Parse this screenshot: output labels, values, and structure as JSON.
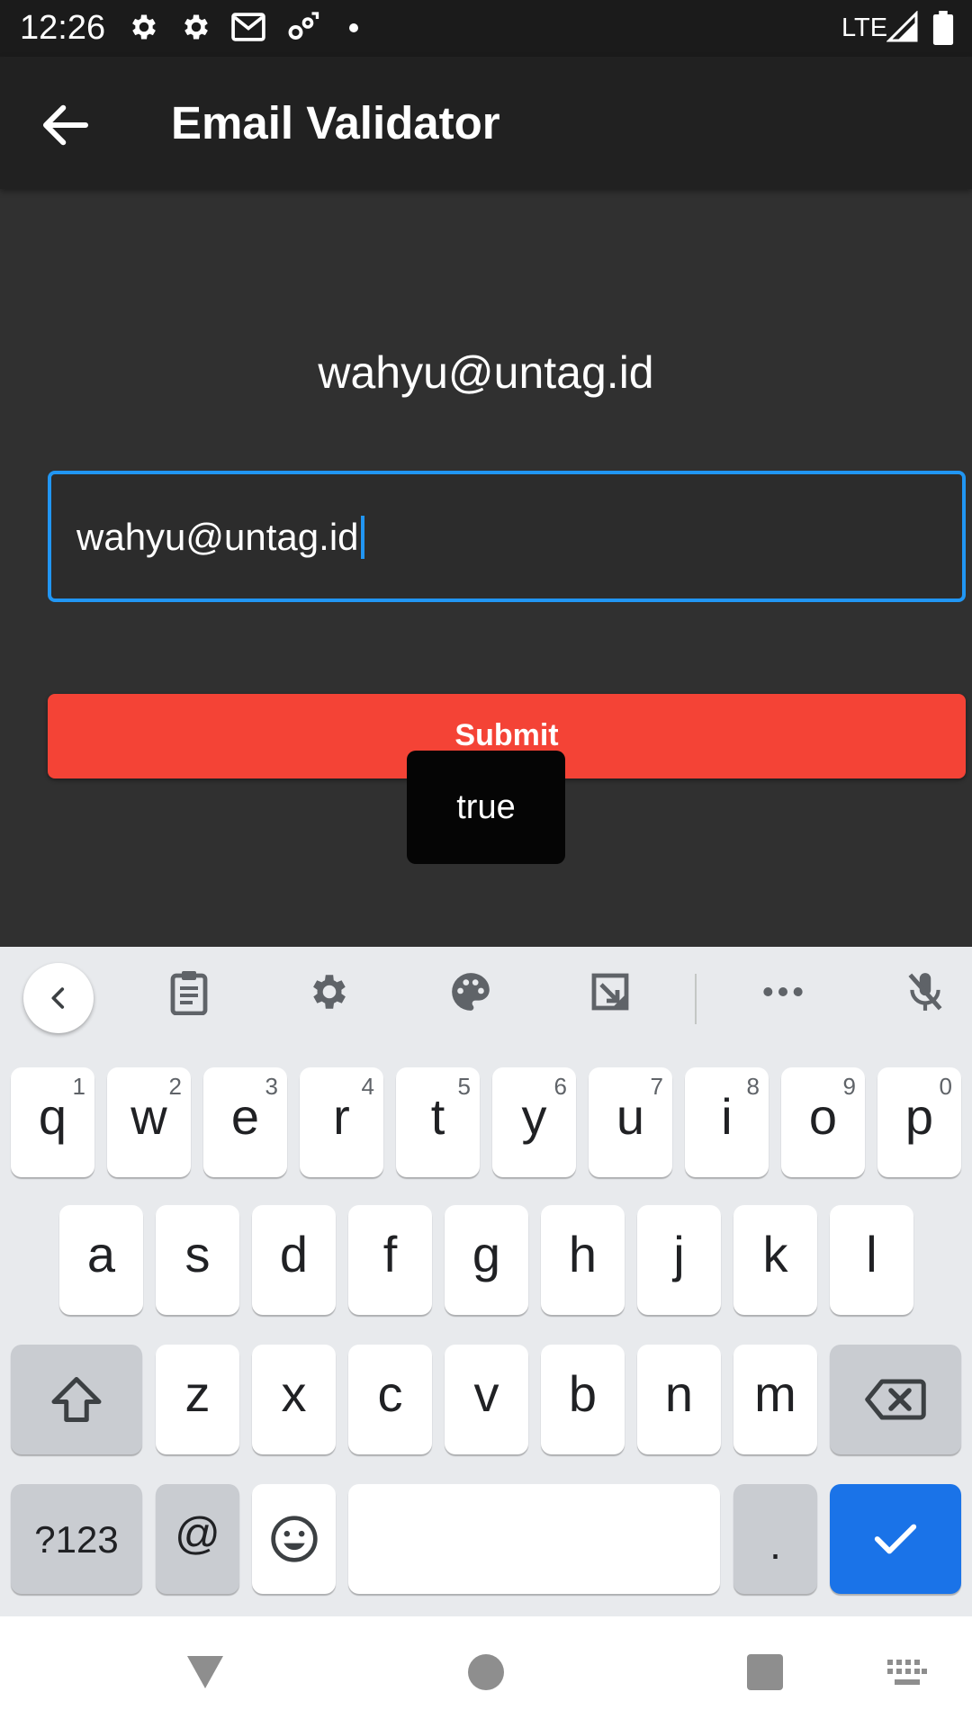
{
  "status_bar": {
    "time": "12:26",
    "network": "LTE",
    "icons": [
      "settings-icon",
      "settings-icon",
      "gmail-icon",
      "sync-icon",
      "notification-dot",
      "signal-icon",
      "battery-icon"
    ]
  },
  "app_bar": {
    "title": "Email Validator",
    "back_icon": "arrow-back-icon"
  },
  "main": {
    "email_display": "wahyu@untag.id",
    "email_input_value": "wahyu@untag.id",
    "submit_label": "Submit",
    "toast_text": "true"
  },
  "keyboard": {
    "toolbar": [
      "chevron-left-icon",
      "clipboard-icon",
      "settings-icon",
      "palette-icon",
      "resize-icon",
      "more-icon",
      "mic-off-icon"
    ],
    "row1": [
      {
        "key": "q",
        "hint": "1"
      },
      {
        "key": "w",
        "hint": "2"
      },
      {
        "key": "e",
        "hint": "3"
      },
      {
        "key": "r",
        "hint": "4"
      },
      {
        "key": "t",
        "hint": "5"
      },
      {
        "key": "y",
        "hint": "6"
      },
      {
        "key": "u",
        "hint": "7"
      },
      {
        "key": "i",
        "hint": "8"
      },
      {
        "key": "o",
        "hint": "9"
      },
      {
        "key": "p",
        "hint": "0"
      }
    ],
    "row2": [
      "a",
      "s",
      "d",
      "f",
      "g",
      "h",
      "j",
      "k",
      "l"
    ],
    "row3": [
      "z",
      "x",
      "c",
      "v",
      "b",
      "n",
      "m"
    ],
    "row4": {
      "symbols": "?123",
      "at": "@",
      "period": "."
    },
    "colors": {
      "key": "#ffffff",
      "modifier": "#c9ccd1",
      "enter": "#1a73e8",
      "background": "#e8eaed"
    }
  },
  "colors": {
    "background": "#303030",
    "app_bar": "#212121",
    "accent": "#2196f3",
    "submit": "#f44336"
  }
}
